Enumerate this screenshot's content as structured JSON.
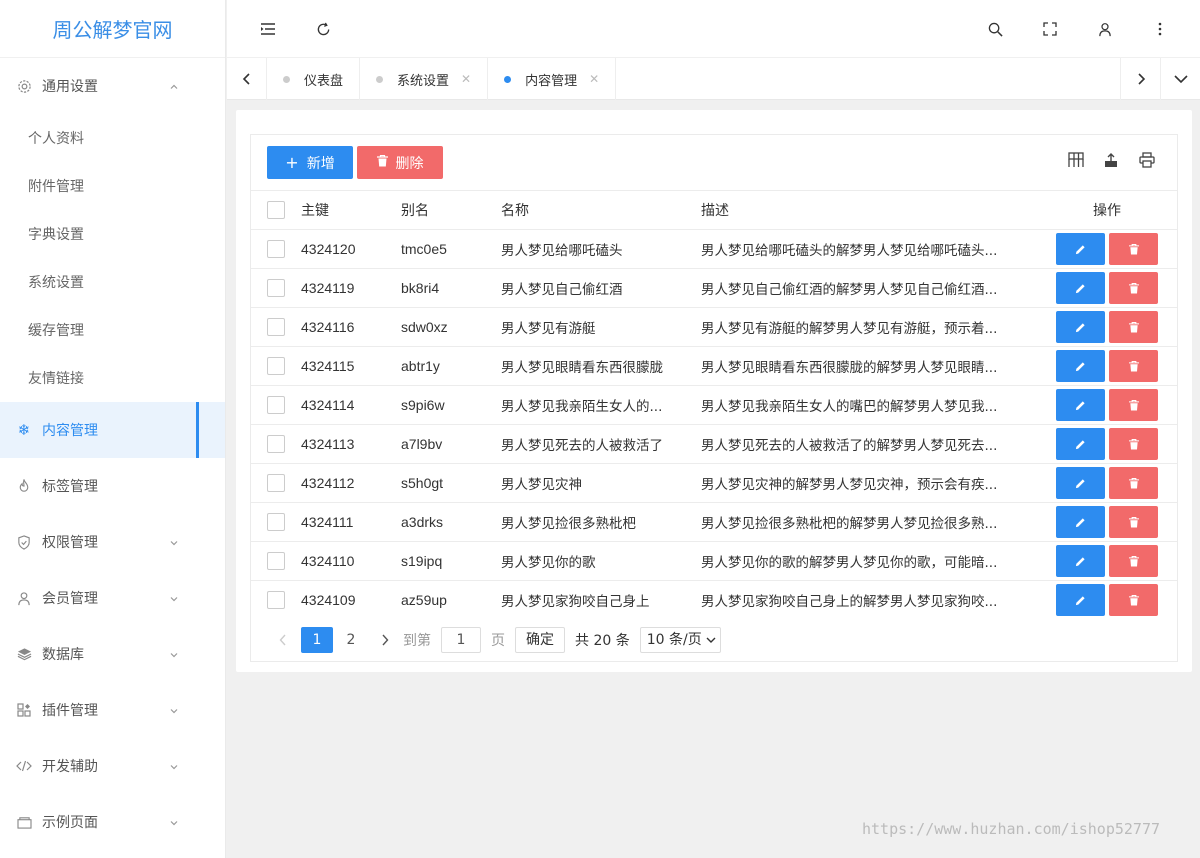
{
  "app": {
    "title": "周公解梦官网"
  },
  "sidebar": {
    "groups": [
      {
        "label": "通用设置",
        "icon": "gear-icon"
      },
      {
        "label": "内容管理",
        "icon": "snowflake-icon"
      },
      {
        "label": "标签管理",
        "icon": "fire-icon"
      },
      {
        "label": "权限管理",
        "icon": "shield-icon"
      },
      {
        "label": "会员管理",
        "icon": "user-icon"
      },
      {
        "label": "数据库",
        "icon": "layers-icon"
      },
      {
        "label": "插件管理",
        "icon": "apps-icon"
      },
      {
        "label": "开发辅助",
        "icon": "code-icon"
      },
      {
        "label": "示例页面",
        "icon": "folder-icon"
      }
    ],
    "sub_items": [
      "个人资料",
      "附件管理",
      "字典设置",
      "系统设置",
      "缓存管理",
      "友情链接"
    ]
  },
  "tabs": [
    {
      "label": "仪表盘",
      "closable": false
    },
    {
      "label": "系统设置",
      "closable": true
    },
    {
      "label": "内容管理",
      "closable": true,
      "active": true
    }
  ],
  "toolbar": {
    "add_label": "新增",
    "delete_label": "删除"
  },
  "table": {
    "headers": {
      "id": "主键",
      "alias": "别名",
      "name": "名称",
      "desc": "描述",
      "ops": "操作"
    },
    "rows": [
      {
        "id": "4324120",
        "alias": "tmc0e5",
        "name": "男人梦见给哪吒磕头",
        "desc": "男人梦见给哪吒磕头的解梦男人梦见给哪吒磕头..."
      },
      {
        "id": "4324119",
        "alias": "bk8ri4",
        "name": "男人梦见自己偷红酒",
        "desc": "男人梦见自己偷红酒的解梦男人梦见自己偷红酒..."
      },
      {
        "id": "4324116",
        "alias": "sdw0xz",
        "name": "男人梦见有游艇",
        "desc": "男人梦见有游艇的解梦男人梦见有游艇，预示着..."
      },
      {
        "id": "4324115",
        "alias": "abtr1y",
        "name": "男人梦见眼睛看东西很朦胧",
        "desc": "男人梦见眼睛看东西很朦胧的解梦男人梦见眼睛..."
      },
      {
        "id": "4324114",
        "alias": "s9pi6w",
        "name": "男人梦见我亲陌生女人的...",
        "desc": "男人梦见我亲陌生女人的嘴巴的解梦男人梦见我..."
      },
      {
        "id": "4324113",
        "alias": "a7l9bv",
        "name": "男人梦见死去的人被救活了",
        "desc": "男人梦见死去的人被救活了的解梦男人梦见死去..."
      },
      {
        "id": "4324112",
        "alias": "s5h0gt",
        "name": "男人梦见灾神",
        "desc": "男人梦见灾神的解梦男人梦见灾神，预示会有疾..."
      },
      {
        "id": "4324111",
        "alias": "a3drks",
        "name": "男人梦见捡很多熟枇杷",
        "desc": "男人梦见捡很多熟枇杷的解梦男人梦见捡很多熟..."
      },
      {
        "id": "4324110",
        "alias": "s19ipq",
        "name": "男人梦见你的歌",
        "desc": "男人梦见你的歌的解梦男人梦见你的歌，可能暗..."
      },
      {
        "id": "4324109",
        "alias": "az59up",
        "name": "男人梦见家狗咬自己身上",
        "desc": "男人梦见家狗咬自己身上的解梦男人梦见家狗咬..."
      }
    ]
  },
  "pagination": {
    "pages": [
      "1",
      "2"
    ],
    "current": "1",
    "goto_prefix": "到第",
    "goto_value": "1",
    "goto_suffix": "页",
    "confirm_label": "确定",
    "total_label": "共 20 条",
    "page_size": "10 条/页"
  },
  "watermark": "https://www.huzhan.com/ishop52777",
  "colors": {
    "primary": "#2d8cf0",
    "danger": "#f26a6a",
    "logo": "#3a8ee6"
  }
}
